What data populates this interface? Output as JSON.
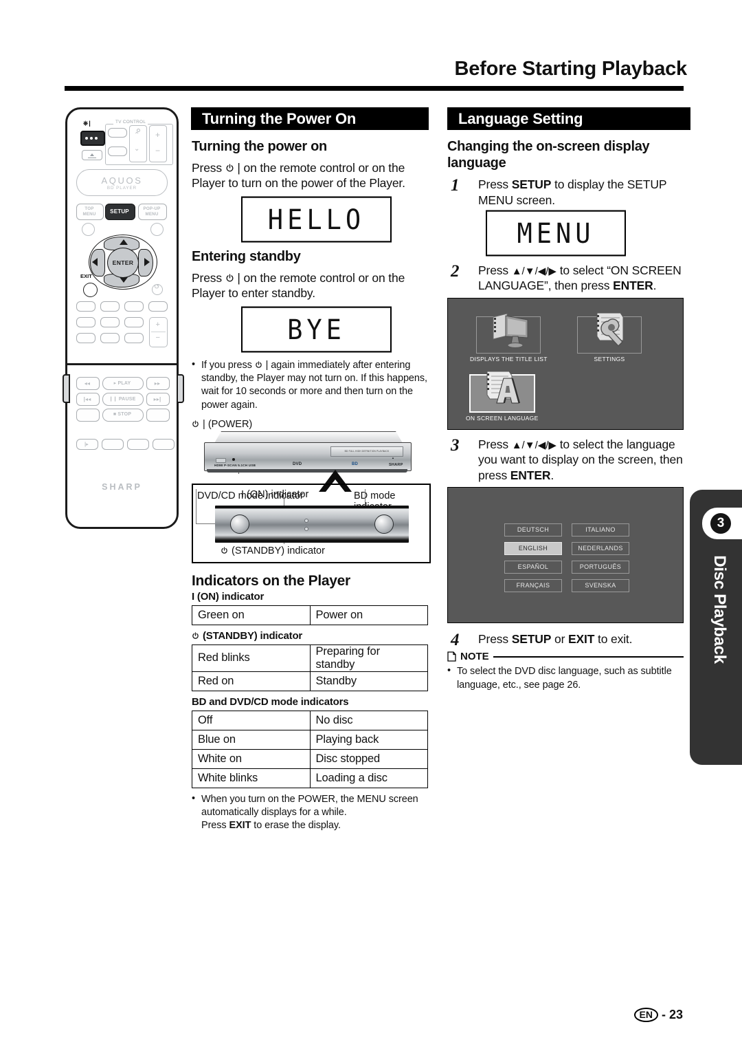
{
  "page": {
    "title": "Before Starting Playback",
    "footer_locale": "EN",
    "footer_page": "- 23"
  },
  "side_tab": {
    "number": "3",
    "label": "Disc Playback"
  },
  "left_column": {
    "section_title": "Turning the Power On",
    "turning_power_on": {
      "heading": "Turning the power on",
      "body_before": "Press",
      "body_after": "| on the remote control or on the Player to turn on the power of the Player.",
      "display": "HELLO"
    },
    "entering_standby": {
      "heading": "Entering standby",
      "body_before": "Press",
      "body_after": "| on the remote control or on the Player to enter standby.",
      "display": "BYE",
      "note_before": "If you press",
      "note_after": "| again immediately after entering standby, the Player may not turn on. If this happens, wait for 10 seconds or more and then turn on the power again."
    },
    "player_diagram": {
      "power_label": "| (POWER)",
      "dvdcd_label": "DVD/CD mode indicator",
      "bd_label": "BD mode indicator",
      "on_label": "I (ON) indicator",
      "standby_label": "(STANDBY) indicator",
      "deck_tray_text": "BD FULL HIGH DEFINITION PLAYBACK",
      "deck_conn_text": "HDMI  P-SCAN  5.1CH  USB",
      "deck_dvd_text": "DVD",
      "deck_bd_text": "BD",
      "deck_brand_text": "SHARP"
    },
    "indicators": {
      "heading": "Indicators on the Player",
      "tables": [
        {
          "caption": "I (ON) indicator",
          "caption_icon": "none",
          "rows": [
            [
              "Green on",
              "Power on"
            ]
          ]
        },
        {
          "caption": "(STANDBY) indicator",
          "caption_icon": "power",
          "rows": [
            [
              "Red blinks",
              "Preparing for standby"
            ],
            [
              "Red on",
              "Standby"
            ]
          ]
        },
        {
          "caption": "BD and DVD/CD mode indicators",
          "caption_icon": "none",
          "rows": [
            [
              "Off",
              "No disc"
            ],
            [
              "Blue on",
              "Playing back"
            ],
            [
              "White on",
              "Disc stopped"
            ],
            [
              "White blinks",
              "Loading a disc"
            ]
          ]
        }
      ],
      "note_line1": "When you turn on the POWER, the MENU screen automatically displays for a while.",
      "note_line2_a": "Press",
      "note_line2_b": "EXIT",
      "note_line2_c": "to erase the display."
    }
  },
  "right_column": {
    "section_title": "Language Setting",
    "heading": "Changing the on-screen display language",
    "steps": [
      {
        "num": "1",
        "text_a": "Press ",
        "bold": "SETUP",
        "text_b": " to display the SETUP MENU screen."
      },
      {
        "num": "2",
        "text_a": "Press ",
        "arrows": "▲/▼/◀/▶",
        "text_b": " to select “ON SCREEN LANGUAGE”, then press ",
        "bold": "ENTER",
        "text_c": "."
      },
      {
        "num": "3",
        "text_a": "Press ",
        "arrows": "▲/▼/◀/▶",
        "text_b": " to select the language you want to display on the screen, then press ",
        "bold": "ENTER",
        "text_c": "."
      },
      {
        "num": "4",
        "text_a": "Press ",
        "bold": "SETUP",
        "text_b": " or ",
        "bold2": "EXIT",
        "text_c": " to exit."
      }
    ],
    "display": "MENU",
    "menu_screen": {
      "items": [
        {
          "caption": "DISPLAYS THE TITLE LIST",
          "icon": "tv-film-icon",
          "selected": false
        },
        {
          "caption": "SETTINGS",
          "icon": "wrench-document-icon",
          "selected": false
        },
        {
          "caption": "ON SCREEN LANGUAGE",
          "icon": "language-document-icon",
          "selected": true
        }
      ]
    },
    "language_screen": {
      "options": [
        {
          "label": "DEUTSCH",
          "selected": false
        },
        {
          "label": "ITALIANO",
          "selected": false
        },
        {
          "label": "ENGLISH",
          "selected": true
        },
        {
          "label": "NEDERLANDS",
          "selected": false
        },
        {
          "label": "ESPAÑOL",
          "selected": false
        },
        {
          "label": "PORTUGUÊS",
          "selected": false
        },
        {
          "label": "FRANÇAIS",
          "selected": false
        },
        {
          "label": "SVENSKA",
          "selected": false
        }
      ]
    },
    "note": {
      "title": "NOTE",
      "body": "To select the DVD disc language, such as subtitle language, etc., see page 26."
    }
  },
  "remote": {
    "tv_control_label": "TV CONTROL",
    "brand": "AQUOS",
    "brand_sub": "BD PLAYER",
    "keys": {
      "power": "POWER",
      "eject": "EJECT",
      "top_menu": "TOP MENU",
      "setup": "SETUP",
      "popup_menu": "POP-UP MENU",
      "enter": "ENTER",
      "exit": "EXIT",
      "play": "PLAY",
      "pause": "PAUSE",
      "stop": "STOP"
    },
    "logo": "SHARP"
  }
}
